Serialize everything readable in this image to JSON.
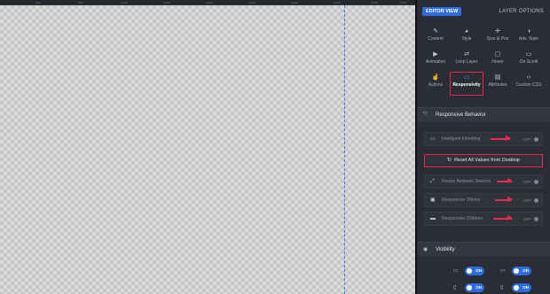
{
  "ruler": {
    "ticks": [
      "900",
      "950",
      "1000",
      "1050",
      "1100",
      "1150",
      "1200",
      "1250",
      "1300",
      "1350"
    ]
  },
  "panel": {
    "editor_view": "EDITOR VIEW",
    "layer_options": "LAYER OPTIONS"
  },
  "options": [
    {
      "label": "Content",
      "icon": "pencil-icon",
      "glyph": "✎"
    },
    {
      "label": "Style",
      "icon": "palette-icon",
      "glyph": "◕"
    },
    {
      "label": "Size & Pos",
      "icon": "crosshair-icon",
      "glyph": "✛"
    },
    {
      "label": "Adv. Style",
      "icon": "contrast-icon",
      "glyph": "◑"
    },
    {
      "label": "Animation",
      "icon": "play-icon",
      "glyph": "▶"
    },
    {
      "label": "Loop Layer",
      "icon": "loop-icon",
      "glyph": "⇄"
    },
    {
      "label": "Hover",
      "icon": "mouse-icon",
      "glyph": "▢"
    },
    {
      "label": "On Scroll",
      "icon": "scroll-screen-icon",
      "glyph": "▭"
    },
    {
      "label": "Actions",
      "icon": "hand-pointer-icon",
      "glyph": "☝"
    },
    {
      "label": "Responsivity",
      "icon": "devices-icon",
      "glyph": "▭"
    },
    {
      "label": "Attributes",
      "icon": "document-icon",
      "glyph": "▤"
    },
    {
      "label": "Custom CSS",
      "icon": "code-icon",
      "glyph": "‹›"
    }
  ],
  "responsive": {
    "title": "Responsive Behavior",
    "rows": [
      {
        "label": "Intelligent Inheriting",
        "state": "OFF",
        "icon": "desktop-mobile-icon",
        "glyph": "▭"
      },
      {
        "label": "Resize Between Devices",
        "state": "OFF",
        "icon": "resize-icon",
        "glyph": "⤢"
      },
      {
        "label": "Responsive Offsets",
        "state": "OFF",
        "icon": "offset-icon",
        "glyph": "▣"
      },
      {
        "label": "Responsive Children",
        "state": "OFF",
        "icon": "folder-icon",
        "glyph": "▬"
      }
    ],
    "reset_label": "Reset All Values from Desktop",
    "reset_icon": "refresh-icon"
  },
  "visibility": {
    "title": "Visibility",
    "toggles": [
      {
        "device": "desktop-icon",
        "glyph": "▭",
        "state": "ON"
      },
      {
        "device": "laptop-icon",
        "glyph": "▭",
        "state": "ON"
      },
      {
        "device": "tablet-icon",
        "glyph": "▯",
        "state": "ON"
      },
      {
        "device": "phone-icon",
        "glyph": "▯",
        "state": "ON"
      }
    ]
  },
  "colors": {
    "accent": "#2e6de0",
    "highlight": "#e8294f",
    "panel": "#2a2d33"
  }
}
